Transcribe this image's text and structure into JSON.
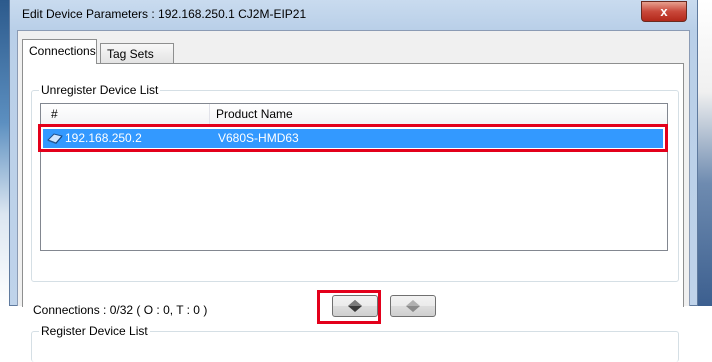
{
  "window": {
    "title": "Edit Device Parameters : 192.168.250.1 CJ2M-EIP21",
    "close_glyph": "x"
  },
  "tabs": [
    {
      "label": "Connections",
      "active": true
    },
    {
      "label": "Tag Sets",
      "active": false
    }
  ],
  "unregister_group": {
    "title": "Unregister Device List",
    "columns": [
      "#",
      "Product Name"
    ],
    "rows": [
      {
        "address": "192.168.250.2",
        "product": "V680S-HMD63",
        "selected": true,
        "icon": "device-icon"
      }
    ]
  },
  "status": {
    "connections_text": "Connections :  0/32 ( O : 0, T : 0 )"
  },
  "buttons": {
    "register_icon": "arrow-down-icon",
    "unregister_icon": "arrow-up-icon"
  },
  "register_group": {
    "title": "Register Device List"
  },
  "colors": {
    "selection": "#3399ff",
    "highlight_frame": "#e3001b",
    "titlebar": "#c9dbef"
  }
}
